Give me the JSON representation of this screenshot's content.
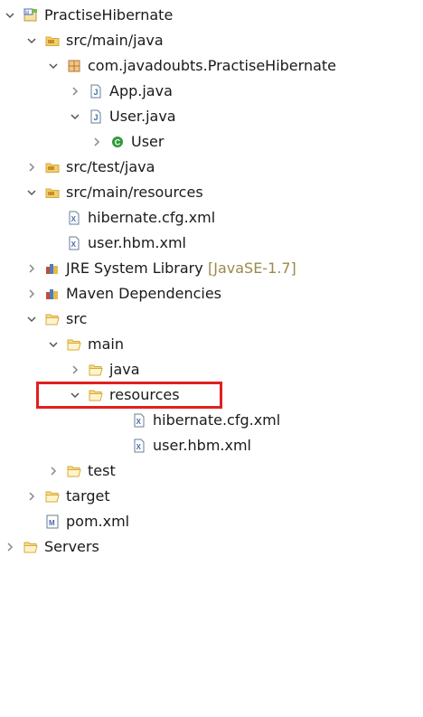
{
  "tree": {
    "rows": [
      {
        "label": "PractiseHibernate",
        "decoration": "",
        "depth": 0,
        "toggle": "expanded",
        "icon": "maven-project-icon"
      },
      {
        "label": "src/main/java",
        "decoration": "",
        "depth": 1,
        "toggle": "expanded",
        "icon": "source-folder-icon"
      },
      {
        "label": "com.javadoubts.PractiseHibernate",
        "decoration": "",
        "depth": 2,
        "toggle": "expanded",
        "icon": "package-icon"
      },
      {
        "label": "App.java",
        "decoration": "",
        "depth": 3,
        "toggle": "collapsed",
        "icon": "java-file-icon"
      },
      {
        "label": "User.java",
        "decoration": "",
        "depth": 3,
        "toggle": "expanded",
        "icon": "java-file-icon"
      },
      {
        "label": "User",
        "decoration": "",
        "depth": 4,
        "toggle": "collapsed",
        "icon": "class-icon"
      },
      {
        "label": "src/test/java",
        "decoration": "",
        "depth": 1,
        "toggle": "collapsed",
        "icon": "source-folder-icon"
      },
      {
        "label": "src/main/resources",
        "decoration": "",
        "depth": 1,
        "toggle": "expanded",
        "icon": "source-folder-icon"
      },
      {
        "label": "hibernate.cfg.xml",
        "decoration": "",
        "depth": 2,
        "toggle": "none",
        "icon": "xml-file-icon"
      },
      {
        "label": "user.hbm.xml",
        "decoration": "",
        "depth": 2,
        "toggle": "none",
        "icon": "xml-file-icon"
      },
      {
        "label": "JRE System Library",
        "decoration": "[JavaSE-1.7]",
        "depth": 1,
        "toggle": "collapsed",
        "icon": "library-icon"
      },
      {
        "label": "Maven Dependencies",
        "decoration": "",
        "depth": 1,
        "toggle": "collapsed",
        "icon": "library-icon"
      },
      {
        "label": "src",
        "decoration": "",
        "depth": 1,
        "toggle": "expanded",
        "icon": "folder-open-icon"
      },
      {
        "label": "main",
        "decoration": "",
        "depth": 2,
        "toggle": "expanded",
        "icon": "folder-open-icon"
      },
      {
        "label": "java",
        "decoration": "",
        "depth": 3,
        "toggle": "collapsed",
        "icon": "folder-open-icon"
      },
      {
        "label": "resources",
        "decoration": "",
        "depth": 3,
        "toggle": "expanded",
        "icon": "folder-open-icon"
      },
      {
        "label": "hibernate.cfg.xml",
        "decoration": "",
        "depth": 5,
        "toggle": "none",
        "icon": "xml-file-icon"
      },
      {
        "label": "user.hbm.xml",
        "decoration": "",
        "depth": 5,
        "toggle": "none",
        "icon": "xml-file-icon"
      },
      {
        "label": "test",
        "decoration": "",
        "depth": 2,
        "toggle": "collapsed",
        "icon": "folder-open-icon"
      },
      {
        "label": "target",
        "decoration": "",
        "depth": 1,
        "toggle": "collapsed",
        "icon": "folder-open-icon"
      },
      {
        "label": "pom.xml",
        "decoration": "",
        "depth": 1,
        "toggle": "none",
        "icon": "maven-pom-icon"
      },
      {
        "label": "Servers",
        "decoration": "",
        "depth": 0,
        "toggle": "collapsed",
        "icon": "folder-open-icon"
      }
    ]
  },
  "colors": {
    "highlight_border": "#e02020",
    "decoration_text": "#9b8a4a",
    "folder": "#d9a93a",
    "java_blue": "#3a6fb0",
    "class_green": "#2e9a3c"
  }
}
